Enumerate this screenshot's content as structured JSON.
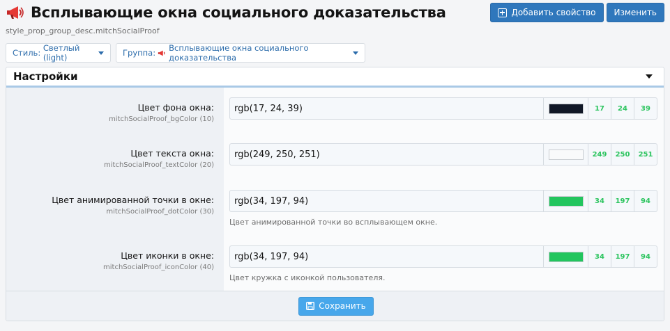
{
  "header": {
    "title": "Всплывающие окна социального доказательства",
    "subtitle_key": "style_prop_group_desc.mitchSocialProof",
    "icon": "megaphone-icon",
    "add_property_label": "Добавить свойство",
    "edit_label": "Изменить"
  },
  "filters": {
    "style_prefix": "Стиль:",
    "style_value": "Светлый (light)",
    "group_prefix": "Группа:",
    "group_value": "Всплывающие окна социального доказательства"
  },
  "block": {
    "title": "Настройки",
    "save_label": "Сохранить"
  },
  "properties": [
    {
      "label": "Цвет фона окна:",
      "key": "mitchSocialProof_bgColor (10)",
      "value": "rgb(17, 24, 39)",
      "swatch": "#111827",
      "r": "17",
      "g": "24",
      "b": "39",
      "hint": ""
    },
    {
      "label": "Цвет текста окна:",
      "key": "mitchSocialProof_textColor (20)",
      "value": "rgb(249, 250, 251)",
      "swatch": "#f9fafb",
      "r": "249",
      "g": "250",
      "b": "251",
      "hint": ""
    },
    {
      "label": "Цвет анимированной точки в окне:",
      "key": "mitchSocialProof_dotColor (30)",
      "value": "rgb(34, 197, 94)",
      "swatch": "#22c55e",
      "r": "34",
      "g": "197",
      "b": "94",
      "hint": "Цвет анимированной точки во всплывающем окне."
    },
    {
      "label": "Цвет иконки в окне:",
      "key": "mitchSocialProof_iconColor (40)",
      "value": "rgb(34, 197, 94)",
      "swatch": "#22c55e",
      "r": "34",
      "g": "197",
      "b": "94",
      "hint": "Цвет кружка с иконкой пользователя."
    }
  ],
  "colors": {
    "accent": "#2f77bc",
    "save": "#47a7eb",
    "channel_text": "#2bc45e"
  }
}
